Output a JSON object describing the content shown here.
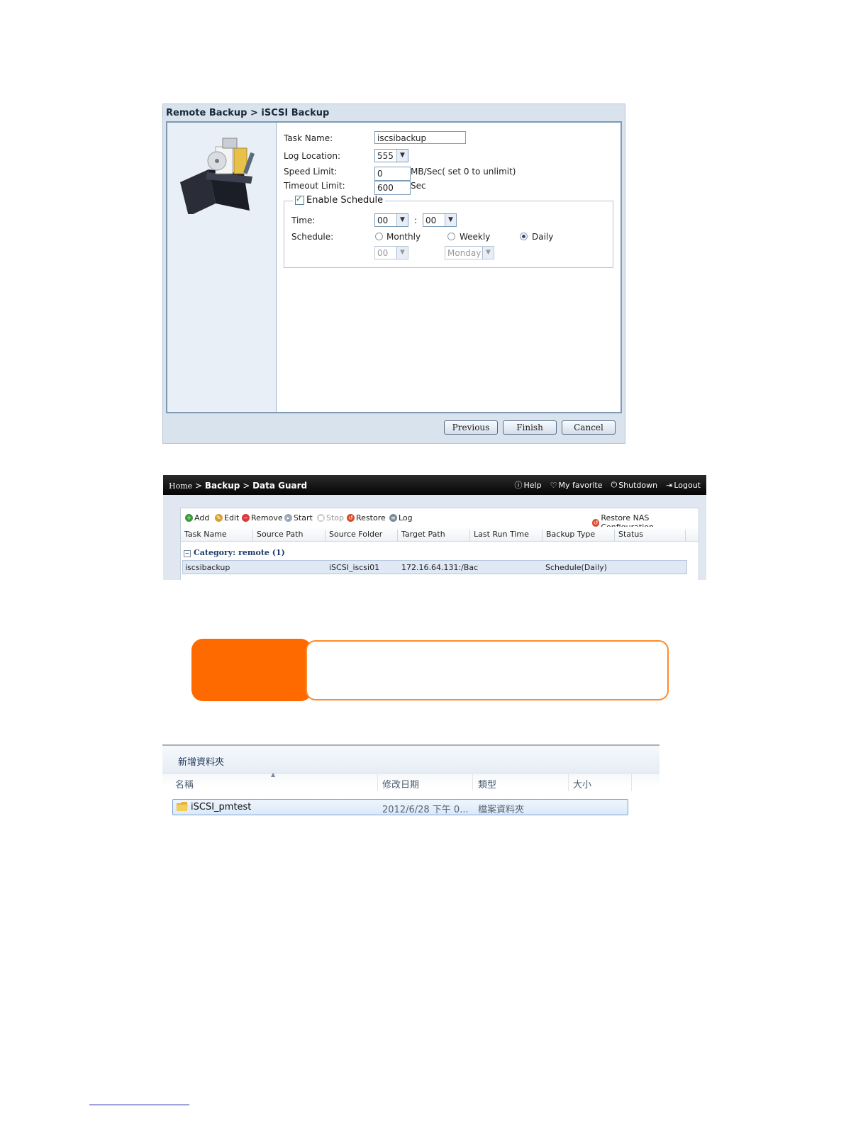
{
  "wizard": {
    "title": "Remote Backup > iSCSI Backup",
    "task_name_label": "Task Name:",
    "task_name_value": "iscsibackup",
    "log_location_label": "Log Location:",
    "log_location_value": "555",
    "speed_limit_label": "Speed Limit:",
    "speed_limit_value": "0",
    "speed_limit_unit": "MB/Sec( set 0 to unlimit)",
    "timeout_limit_label": "Timeout Limit:",
    "timeout_limit_value": "600",
    "timeout_limit_unit": "Sec",
    "enable_schedule_label": "Enable Schedule",
    "time_label": "Time:",
    "time_hour": "00",
    "time_sep": ":",
    "time_minute": "00",
    "schedule_label": "Schedule:",
    "schedule_options": [
      "Monthly",
      "Weekly",
      "Daily"
    ],
    "schedule_selected": "Daily",
    "monthly_day": "00",
    "weekly_day": "Monday",
    "buttons": {
      "previous": "Previous",
      "finish": "Finish",
      "cancel": "Cancel"
    }
  },
  "data_guard": {
    "breadcrumb": {
      "home": "Home",
      "sep1": ">",
      "backup": "Backup",
      "sep2": ">",
      "page": "Data Guard"
    },
    "topnav": {
      "help": "Help",
      "favorite": "My favorite",
      "shutdown": "Shutdown",
      "logout": "Logout"
    },
    "toolbar": {
      "add": "Add",
      "edit": "Edit",
      "remove": "Remove",
      "start": "Start",
      "stop": "Stop",
      "restore": "Restore",
      "log": "Log",
      "restore_nas": "Restore NAS Configuration"
    },
    "columns": [
      "Task Name",
      "Source Path",
      "Source Folder",
      "Target Path",
      "Last Run Time",
      "Backup Type",
      "Status"
    ],
    "category": "Category: remote (1)",
    "rows": [
      {
        "task_name": "iscsibackup",
        "source_path": "",
        "source_folder": "iSCSI_iscsi01",
        "target_path": "172.16.64.131:/Bac",
        "last_run_time": "",
        "backup_type": "Schedule(Daily)",
        "status": ""
      }
    ]
  },
  "explorer": {
    "new_folder": "新增資料夾",
    "columns": [
      "名稱",
      "修改日期",
      "類型",
      "大小"
    ],
    "rows": [
      {
        "name": "iSCSI_pmtest",
        "modified": "2012/6/28 下午 0...",
        "type": "檔案資料夾",
        "size": ""
      }
    ]
  },
  "colors": {
    "note_accent": "#ff6a00",
    "header_bar": "#1a1a1a",
    "selection": "#dfe8f4"
  },
  "icons": [
    "add-icon",
    "edit-icon",
    "remove-icon",
    "start-icon",
    "stop-icon",
    "restore-icon",
    "log-icon",
    "help-icon",
    "favorite-icon",
    "power-icon",
    "logout-icon",
    "folder-icon",
    "backup-box-icon"
  ]
}
